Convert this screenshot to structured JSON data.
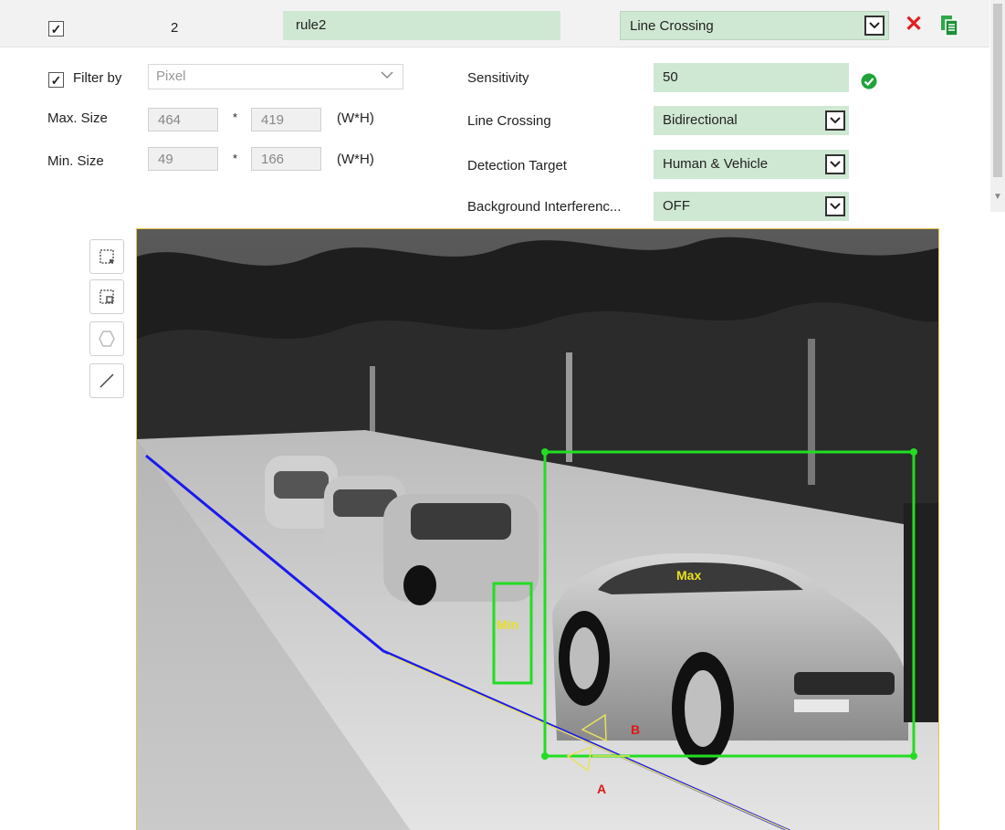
{
  "rule": {
    "enabled": true,
    "number": "2",
    "name": "rule2",
    "type": "Line Crossing"
  },
  "filter": {
    "enabled": true,
    "label": "Filter by",
    "mode": "Pixel",
    "max_label": "Max. Size",
    "max_w": "464",
    "max_h": "419",
    "min_label": "Min. Size",
    "min_w": "49",
    "min_h": "166",
    "times": "*",
    "unit": "(W*H)"
  },
  "settings": {
    "sensitivity_label": "Sensitivity",
    "sensitivity_value": "50",
    "line_crossing_label": "Line Crossing",
    "line_crossing_value": "Bidirectional",
    "detection_target_label": "Detection Target",
    "detection_target_value": "Human & Vehicle",
    "bg_interference_label": "Background Interferenc...",
    "bg_interference_value": "OFF"
  },
  "tools": [
    {
      "name": "max-size-tool-icon"
    },
    {
      "name": "min-size-tool-icon"
    },
    {
      "name": "polygon-tool-icon"
    },
    {
      "name": "line-tool-icon"
    }
  ],
  "overlay": {
    "max_label": "Max",
    "min_label": "Min",
    "side_a": "A",
    "side_b": "B"
  },
  "colors": {
    "accent_green": "#cfe8d3",
    "box_green": "#22dd22",
    "line_blue": "#1a1aee",
    "line_yellow": "#e8e060",
    "delete_red": "#e02020",
    "label_yellow": "#e8e020",
    "label_red": "#e01818"
  }
}
